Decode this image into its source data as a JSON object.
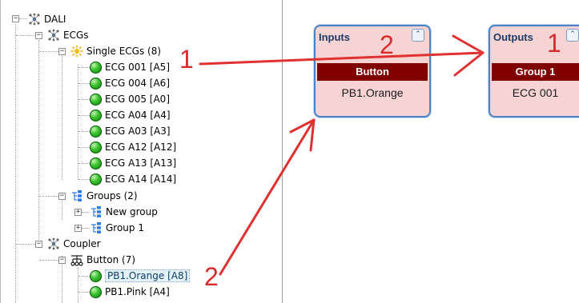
{
  "tree": {
    "root": {
      "label": "DALI",
      "icon": "network-icon"
    },
    "ecgs": {
      "label": "ECGs",
      "icon": "network-icon"
    },
    "single_ecgs": {
      "label": "Single ECGs (8)",
      "icon": "sun-icon",
      "items": [
        "ECG 001 [A5]",
        "ECG 004 [A6]",
        "ECG 005 [A0]",
        "ECG A04 [A4]",
        "ECG A03 [A3]",
        "ECG A12 [A12]",
        "ECG A13 [A13]",
        "ECG A14 [A14]"
      ]
    },
    "groups": {
      "label": "Groups (2)",
      "icon": "group-icon",
      "items": [
        "New group",
        "Group 1"
      ]
    },
    "coupler": {
      "label": "Coupler",
      "icon": "network-icon"
    },
    "button": {
      "label": "Button (7)",
      "icon": "button-tree-icon",
      "items": [
        "PB1.Orange [A8]",
        "PB1.Pink [A4]"
      ]
    },
    "expander_minus": "−",
    "expander_plus": "+"
  },
  "inputs_node": {
    "title": "Inputs",
    "collapse_glyph": "⌃",
    "header": "Button",
    "item": "PB1.Orange"
  },
  "outputs_node": {
    "title": "Outputs",
    "collapse_glyph": "⌃",
    "header": "Group 1",
    "item": "ECG 001"
  },
  "annotations": {
    "label_1_left": "1",
    "label_1_right": "1",
    "label_2_top": "2",
    "label_2_bottom": "2",
    "color": "#d92b2b"
  },
  "colors": {
    "node_border": "#4a82c7",
    "node_fill": "#f7d4d4",
    "node_header": "#800000",
    "ecg_ball": "#39c22e"
  }
}
